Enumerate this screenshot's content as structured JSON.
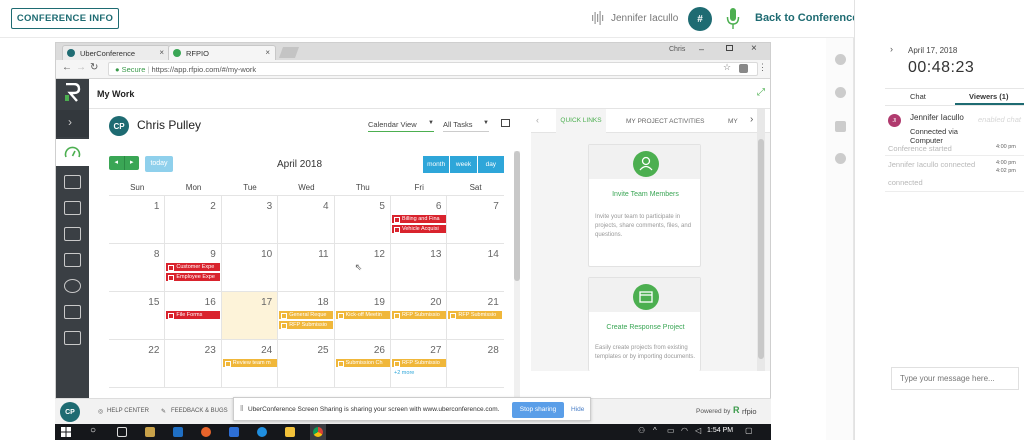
{
  "header": {
    "conference_info": "CONFERENCE INFO",
    "host_name": "Jennifer Iacullo",
    "hash_label": "#",
    "back_label": "Back to Conference"
  },
  "sidebar": {
    "date": "April 17, 2018",
    "timer": "00:48:23",
    "tab_chat": "Chat",
    "tab_viewers": "Viewers (1)",
    "avatar_initials": "JI",
    "viewer_name": "Jennifer Iacullo",
    "viewer_status": "Connected via Computer",
    "ghost_text": "enabled chat",
    "log": [
      {
        "text": "Conference started",
        "time": "4:00 pm"
      },
      {
        "text": "Jennifer Iacullo connected",
        "time": "4:00 pm"
      },
      {
        "text": "connected",
        "time": "4:02 pm"
      }
    ],
    "message_placeholder": "Type your message here..."
  },
  "browser": {
    "tabs": [
      {
        "label": "UberConference",
        "icon_color": "#1e6b72"
      },
      {
        "label": "RFPIO",
        "icon_color": "#3aa655"
      }
    ],
    "profile_label": "Chris",
    "secure_label": "Secure",
    "url": "https://app.rfpio.com/#/my-work"
  },
  "app": {
    "page_title": "My Work",
    "user_initials": "CP",
    "user_name": "Chris Pulley",
    "view_select": "Calendar View",
    "task_select": "All Tasks",
    "today_label": "today",
    "month_title": "April 2018",
    "view_buttons": [
      "month",
      "week",
      "day"
    ],
    "day_headers": [
      "Sun",
      "Mon",
      "Tue",
      "Wed",
      "Thu",
      "Fri",
      "Sat"
    ],
    "weeks": [
      [
        "1",
        "2",
        "3",
        "4",
        "5",
        "6",
        "7"
      ],
      [
        "8",
        "9",
        "10",
        "11",
        "12",
        "13",
        "14"
      ],
      [
        "15",
        "16",
        "17",
        "18",
        "19",
        "20",
        "21"
      ],
      [
        "22",
        "23",
        "24",
        "25",
        "26",
        "27",
        "28"
      ]
    ],
    "events": {
      "fri6a": "Billing and Fina",
      "fri6b": "Vehicle Acquisi",
      "mon9a": "Customer Expe",
      "mon9b": "Employee Expe",
      "mon16": "File Forms",
      "wed18a": "General Reque",
      "wed18b": "RFP Submissio",
      "thu19": "Kick-off Meetin",
      "fri20": "RFP Submissio",
      "sat21": "RFP Submissio",
      "tue24": "Review team m",
      "thu26": "Submission Ch",
      "fri27": "RFP Submissio",
      "more": "+2 more"
    },
    "quick_tabs": [
      "QUICK LINKS",
      "MY PROJECT ACTIVITIES",
      "MY"
    ],
    "card1_title": "Invite Team Members",
    "card1_desc": "Invite your team to participate in projects, share comments, files, and questions.",
    "card2_title": "Create Response Project",
    "card2_desc": "Easily create projects from existing templates or by importing documents.",
    "help_center": "HELP CENTER",
    "feedback": "FEEDBACK & BUGS",
    "powered_by": "Powered by",
    "brand": "rfpio"
  },
  "share": {
    "message": "UberConference Screen Sharing is sharing your screen with www.uberconference.com.",
    "stop": "Stop sharing",
    "hide": "Hide"
  },
  "taskbar": {
    "clock": "1:54 PM"
  },
  "colors": {
    "brand_teal": "#1e6b72",
    "cal_blue": "#2ea6d9",
    "event_red": "#d9232d",
    "event_yellow": "#f0b73a",
    "highlight": "#fdf3d9",
    "quick_green": "#4caf50"
  }
}
